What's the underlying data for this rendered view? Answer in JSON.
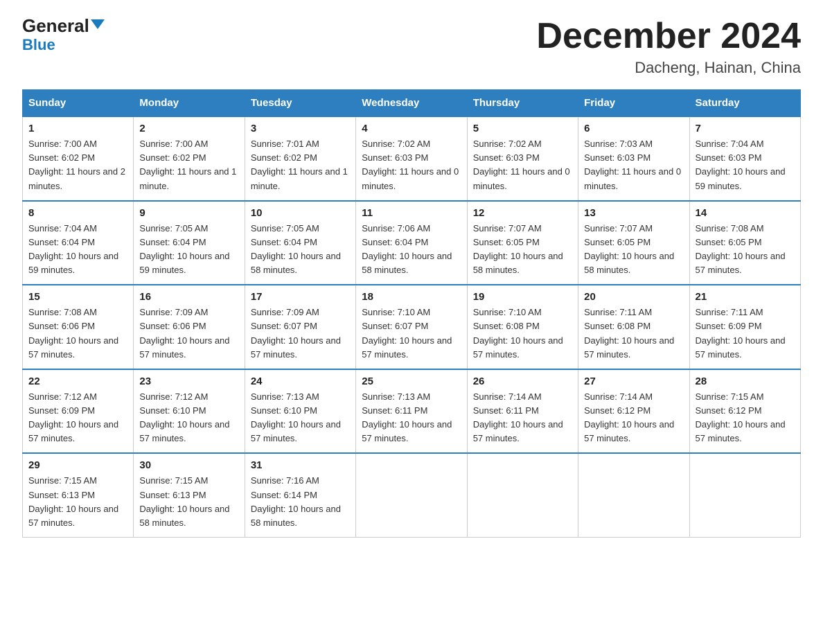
{
  "header": {
    "logo_general": "General",
    "logo_blue": "Blue",
    "month_title": "December 2024",
    "location": "Dacheng, Hainan, China"
  },
  "days_of_week": [
    "Sunday",
    "Monday",
    "Tuesday",
    "Wednesday",
    "Thursday",
    "Friday",
    "Saturday"
  ],
  "weeks": [
    [
      {
        "day": "1",
        "sunrise": "7:00 AM",
        "sunset": "6:02 PM",
        "daylight": "11 hours and 2 minutes."
      },
      {
        "day": "2",
        "sunrise": "7:00 AM",
        "sunset": "6:02 PM",
        "daylight": "11 hours and 1 minute."
      },
      {
        "day": "3",
        "sunrise": "7:01 AM",
        "sunset": "6:02 PM",
        "daylight": "11 hours and 1 minute."
      },
      {
        "day": "4",
        "sunrise": "7:02 AM",
        "sunset": "6:03 PM",
        "daylight": "11 hours and 0 minutes."
      },
      {
        "day": "5",
        "sunrise": "7:02 AM",
        "sunset": "6:03 PM",
        "daylight": "11 hours and 0 minutes."
      },
      {
        "day": "6",
        "sunrise": "7:03 AM",
        "sunset": "6:03 PM",
        "daylight": "11 hours and 0 minutes."
      },
      {
        "day": "7",
        "sunrise": "7:04 AM",
        "sunset": "6:03 PM",
        "daylight": "10 hours and 59 minutes."
      }
    ],
    [
      {
        "day": "8",
        "sunrise": "7:04 AM",
        "sunset": "6:04 PM",
        "daylight": "10 hours and 59 minutes."
      },
      {
        "day": "9",
        "sunrise": "7:05 AM",
        "sunset": "6:04 PM",
        "daylight": "10 hours and 59 minutes."
      },
      {
        "day": "10",
        "sunrise": "7:05 AM",
        "sunset": "6:04 PM",
        "daylight": "10 hours and 58 minutes."
      },
      {
        "day": "11",
        "sunrise": "7:06 AM",
        "sunset": "6:04 PM",
        "daylight": "10 hours and 58 minutes."
      },
      {
        "day": "12",
        "sunrise": "7:07 AM",
        "sunset": "6:05 PM",
        "daylight": "10 hours and 58 minutes."
      },
      {
        "day": "13",
        "sunrise": "7:07 AM",
        "sunset": "6:05 PM",
        "daylight": "10 hours and 58 minutes."
      },
      {
        "day": "14",
        "sunrise": "7:08 AM",
        "sunset": "6:05 PM",
        "daylight": "10 hours and 57 minutes."
      }
    ],
    [
      {
        "day": "15",
        "sunrise": "7:08 AM",
        "sunset": "6:06 PM",
        "daylight": "10 hours and 57 minutes."
      },
      {
        "day": "16",
        "sunrise": "7:09 AM",
        "sunset": "6:06 PM",
        "daylight": "10 hours and 57 minutes."
      },
      {
        "day": "17",
        "sunrise": "7:09 AM",
        "sunset": "6:07 PM",
        "daylight": "10 hours and 57 minutes."
      },
      {
        "day": "18",
        "sunrise": "7:10 AM",
        "sunset": "6:07 PM",
        "daylight": "10 hours and 57 minutes."
      },
      {
        "day": "19",
        "sunrise": "7:10 AM",
        "sunset": "6:08 PM",
        "daylight": "10 hours and 57 minutes."
      },
      {
        "day": "20",
        "sunrise": "7:11 AM",
        "sunset": "6:08 PM",
        "daylight": "10 hours and 57 minutes."
      },
      {
        "day": "21",
        "sunrise": "7:11 AM",
        "sunset": "6:09 PM",
        "daylight": "10 hours and 57 minutes."
      }
    ],
    [
      {
        "day": "22",
        "sunrise": "7:12 AM",
        "sunset": "6:09 PM",
        "daylight": "10 hours and 57 minutes."
      },
      {
        "day": "23",
        "sunrise": "7:12 AM",
        "sunset": "6:10 PM",
        "daylight": "10 hours and 57 minutes."
      },
      {
        "day": "24",
        "sunrise": "7:13 AM",
        "sunset": "6:10 PM",
        "daylight": "10 hours and 57 minutes."
      },
      {
        "day": "25",
        "sunrise": "7:13 AM",
        "sunset": "6:11 PM",
        "daylight": "10 hours and 57 minutes."
      },
      {
        "day": "26",
        "sunrise": "7:14 AM",
        "sunset": "6:11 PM",
        "daylight": "10 hours and 57 minutes."
      },
      {
        "day": "27",
        "sunrise": "7:14 AM",
        "sunset": "6:12 PM",
        "daylight": "10 hours and 57 minutes."
      },
      {
        "day": "28",
        "sunrise": "7:15 AM",
        "sunset": "6:12 PM",
        "daylight": "10 hours and 57 minutes."
      }
    ],
    [
      {
        "day": "29",
        "sunrise": "7:15 AM",
        "sunset": "6:13 PM",
        "daylight": "10 hours and 57 minutes."
      },
      {
        "day": "30",
        "sunrise": "7:15 AM",
        "sunset": "6:13 PM",
        "daylight": "10 hours and 58 minutes."
      },
      {
        "day": "31",
        "sunrise": "7:16 AM",
        "sunset": "6:14 PM",
        "daylight": "10 hours and 58 minutes."
      },
      null,
      null,
      null,
      null
    ]
  ]
}
